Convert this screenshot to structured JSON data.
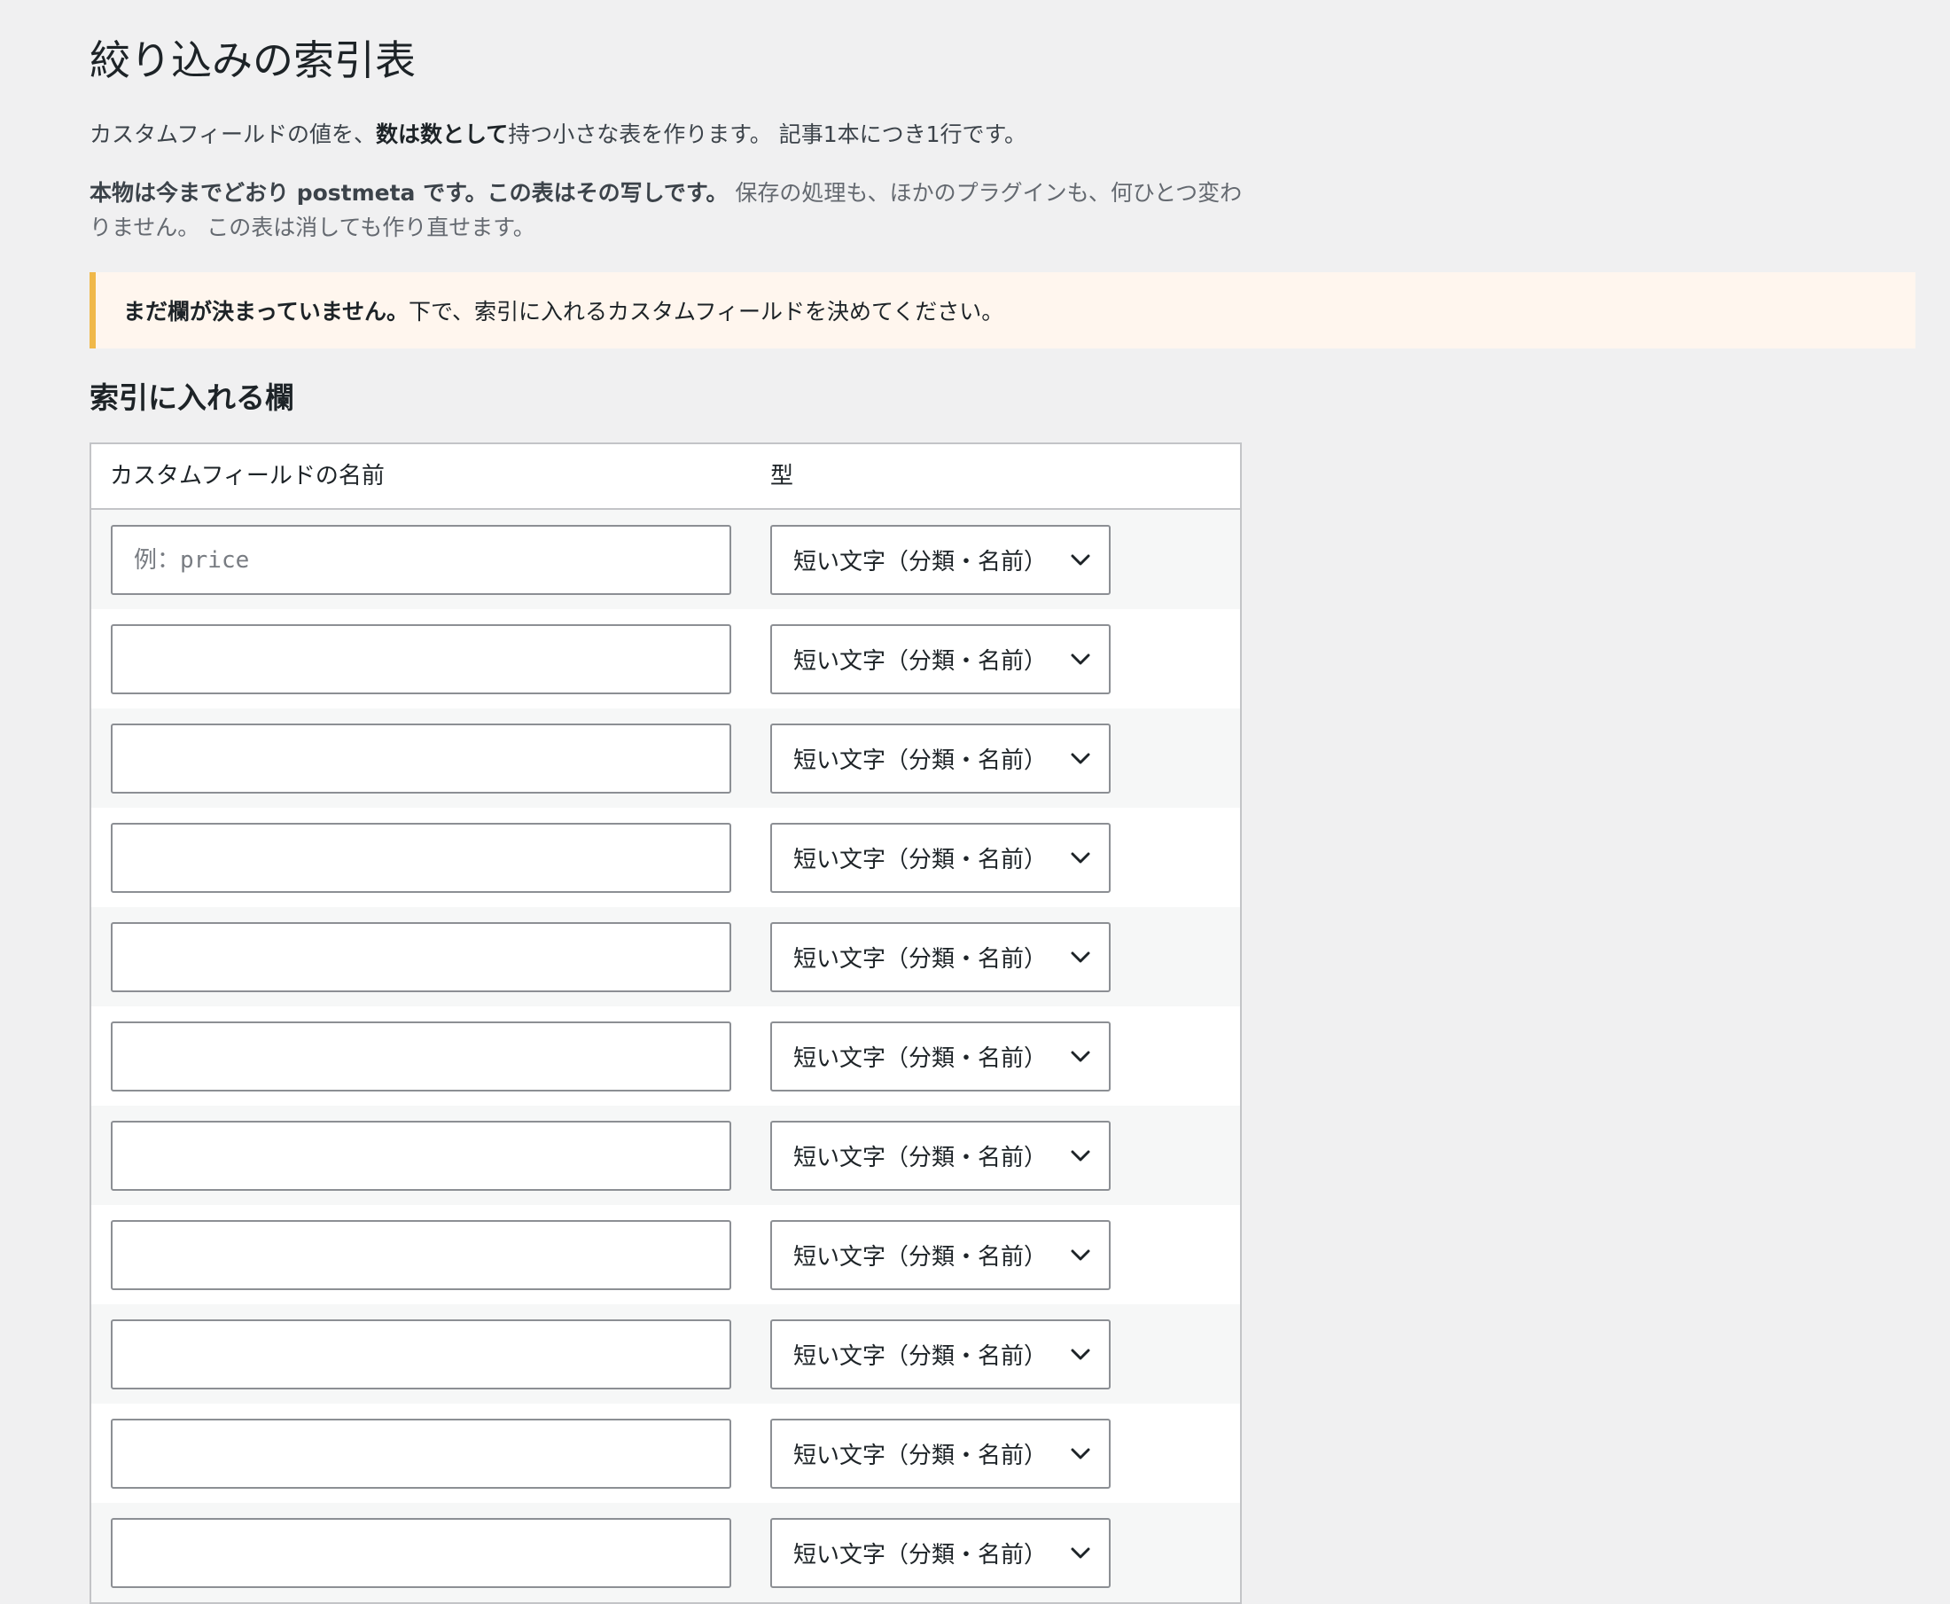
{
  "page": {
    "title": "絞り込みの索引表"
  },
  "intro": {
    "part1": "カスタムフィールドの値を、",
    "bold": "数は数として",
    "part2": "持つ小さな表を作ります。 記事1本につき1行です。"
  },
  "note": {
    "bold": "本物は今までどおり postmeta です。この表はその写しです。",
    "rest": " 保存の処理も、ほかのプラグインも、何ひとつ変わりません。 この表は消しても作り直せます。"
  },
  "notice": {
    "bold": "まだ欄が決まっていません。",
    "text": "下で、索引に入れるカスタムフィールドを決めてください。",
    "accent_color": "#f0b849",
    "background_color": "#fff6ee"
  },
  "section": {
    "title": "索引に入れる欄"
  },
  "table": {
    "headers": {
      "name": "カスタムフィールドの名前",
      "type": "型"
    },
    "rows": [
      {
        "name_value": "",
        "name_placeholder": "例：price",
        "type_selected": "短い文字（分類・名前）"
      },
      {
        "name_value": "",
        "name_placeholder": "",
        "type_selected": "短い文字（分類・名前）"
      },
      {
        "name_value": "",
        "name_placeholder": "",
        "type_selected": "短い文字（分類・名前）"
      },
      {
        "name_value": "",
        "name_placeholder": "",
        "type_selected": "短い文字（分類・名前）"
      },
      {
        "name_value": "",
        "name_placeholder": "",
        "type_selected": "短い文字（分類・名前）"
      },
      {
        "name_value": "",
        "name_placeholder": "",
        "type_selected": "短い文字（分類・名前）"
      },
      {
        "name_value": "",
        "name_placeholder": "",
        "type_selected": "短い文字（分類・名前）"
      },
      {
        "name_value": "",
        "name_placeholder": "",
        "type_selected": "短い文字（分類・名前）"
      },
      {
        "name_value": "",
        "name_placeholder": "",
        "type_selected": "短い文字（分類・名前）"
      },
      {
        "name_value": "",
        "name_placeholder": "",
        "type_selected": "短い文字（分類・名前）"
      },
      {
        "name_value": "",
        "name_placeholder": "",
        "type_selected": "短い文字（分類・名前）"
      }
    ]
  }
}
